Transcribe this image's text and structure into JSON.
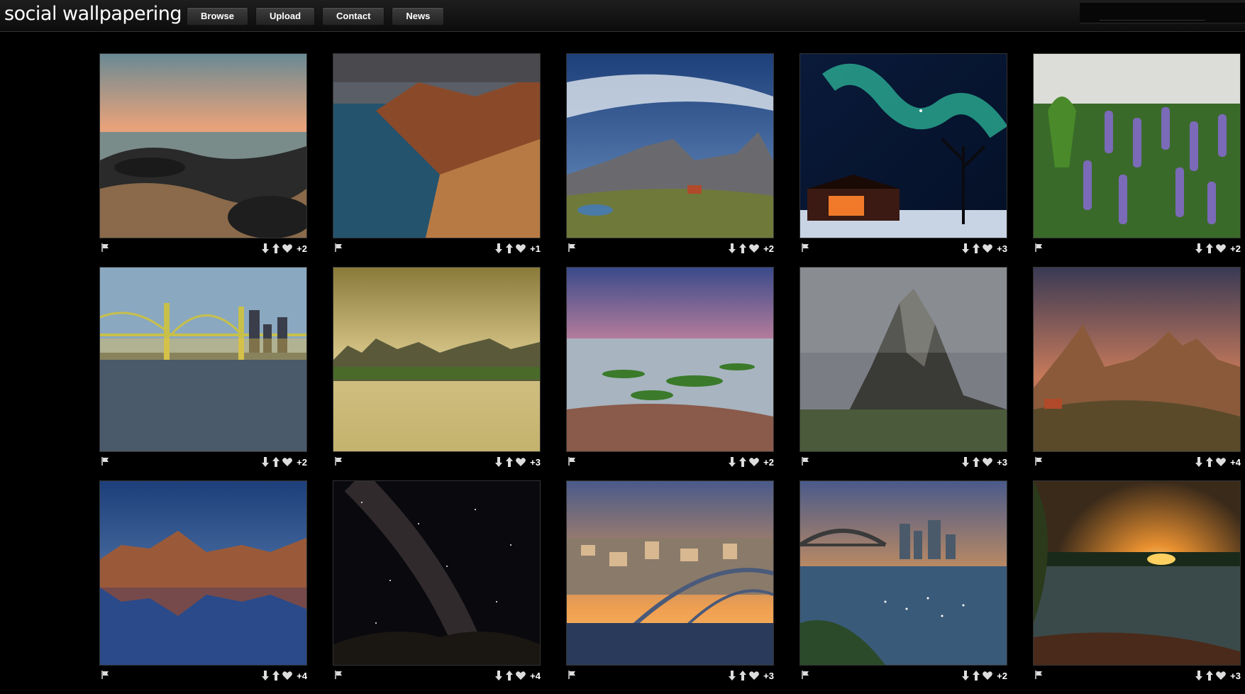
{
  "site": {
    "logo": "social wallpapering"
  },
  "nav": [
    {
      "label": "Browse"
    },
    {
      "label": "Upload"
    },
    {
      "label": "Contact"
    },
    {
      "label": "News"
    }
  ],
  "search": {
    "placeholder": ""
  },
  "wallpapers": [
    {
      "scene": "rocky-coast-sunset",
      "votes": "+2"
    },
    {
      "scene": "sea-cliffs",
      "votes": "+1"
    },
    {
      "scene": "alpine-peaks-hut",
      "votes": "+2"
    },
    {
      "scene": "aurora-cabin",
      "votes": "+3"
    },
    {
      "scene": "lupine-field",
      "votes": "+2"
    },
    {
      "scene": "suspension-bridge-city",
      "votes": "+2"
    },
    {
      "scene": "karst-reflection",
      "votes": "+3"
    },
    {
      "scene": "mossy-shore-dawn",
      "votes": "+2"
    },
    {
      "scene": "misty-mountain-peak",
      "votes": "+3"
    },
    {
      "scene": "dolomites-sunset",
      "votes": "+4"
    },
    {
      "scene": "mountain-lake-reflection",
      "votes": "+4"
    },
    {
      "scene": "milky-way",
      "votes": "+4"
    },
    {
      "scene": "city-arch-bridge",
      "votes": "+3"
    },
    {
      "scene": "harbour-bridge-sunset",
      "votes": "+2"
    },
    {
      "scene": "lake-sunset-trees",
      "votes": "+3"
    }
  ],
  "colors": {
    "background": "#000000",
    "text": "#ffffff",
    "icon": "#dddddd"
  }
}
